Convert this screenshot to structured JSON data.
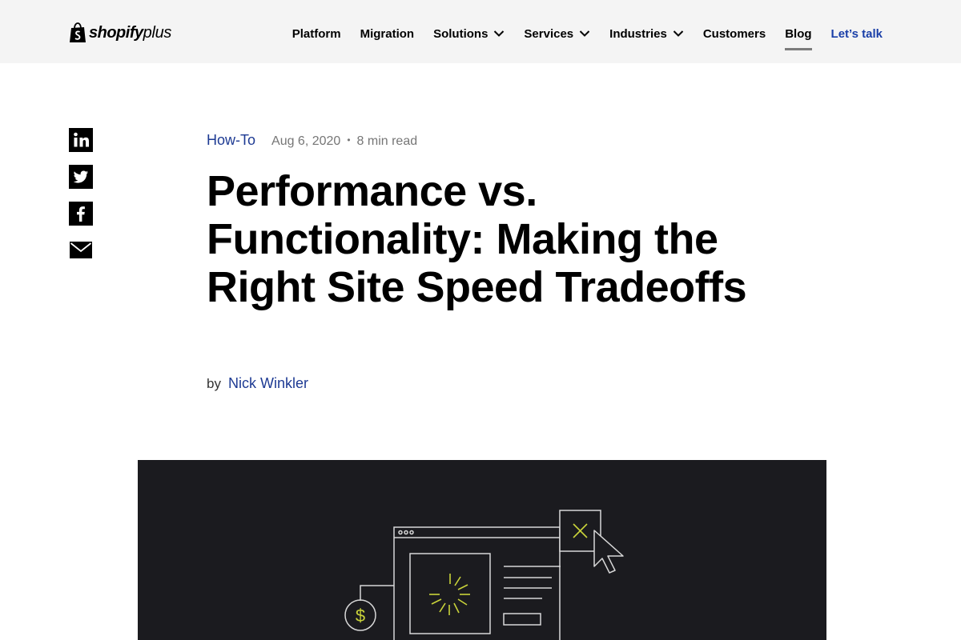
{
  "header": {
    "logo": {
      "wordmark": "shopify",
      "suffix": "plus",
      "icon": "shopping-bag-icon"
    },
    "nav": [
      {
        "label": "Platform",
        "dropdown": false
      },
      {
        "label": "Migration",
        "dropdown": false
      },
      {
        "label": "Solutions",
        "dropdown": true
      },
      {
        "label": "Services",
        "dropdown": true
      },
      {
        "label": "Industries",
        "dropdown": true
      },
      {
        "label": "Customers",
        "dropdown": false
      },
      {
        "label": "Blog",
        "dropdown": false,
        "active": true
      },
      {
        "label": "Let’s talk",
        "dropdown": false,
        "cta": true
      }
    ]
  },
  "share": [
    "linkedin-icon",
    "twitter-icon",
    "facebook-icon",
    "email-icon"
  ],
  "article": {
    "category": "How-To",
    "date": "Aug 6, 2020",
    "separator": "•",
    "read_time": "8 min read",
    "title": "Performance vs. Functionality: Making the Right Site Speed Tradeoffs",
    "by_label": "by",
    "author": "Nick Winkler"
  },
  "hero": {
    "illustration_icons": [
      "browser-window-icon",
      "loading-spinner-icon",
      "dollar-coin-icon",
      "close-box-icon",
      "cursor-arrow-icon"
    ]
  },
  "colors": {
    "header_bg": "#f4f4f4",
    "link_blue": "#1d3a93",
    "cta_blue": "#1a3fa8",
    "hero_bg": "#1b1b1f",
    "accent_yellow": "#c9d33a",
    "active_underline": "#7b7b7b"
  }
}
